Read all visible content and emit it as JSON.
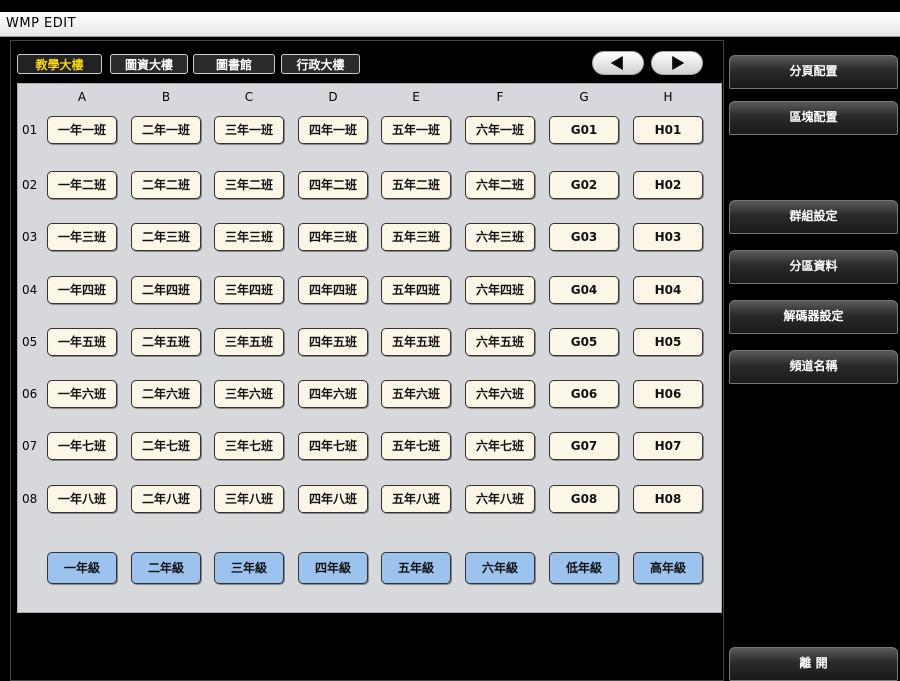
{
  "window": {
    "title": "WMP EDIT"
  },
  "buildings": [
    {
      "label": "教學大樓",
      "active": true
    },
    {
      "label": "圖資大樓",
      "active": false
    },
    {
      "label": "圖書館",
      "active": false
    },
    {
      "label": "行政大樓",
      "active": false
    }
  ],
  "columns": [
    "A",
    "B",
    "C",
    "D",
    "E",
    "F",
    "G",
    "H"
  ],
  "rows": [
    "01",
    "02",
    "03",
    "04",
    "05",
    "06",
    "07",
    "08"
  ],
  "cells": [
    [
      "一年一班",
      "二年一班",
      "三年一班",
      "四年一班",
      "五年一班",
      "六年一班",
      "G01",
      "H01"
    ],
    [
      "一年二班",
      "二年二班",
      "三年二班",
      "四年二班",
      "五年二班",
      "六年二班",
      "G02",
      "H02"
    ],
    [
      "一年三班",
      "二年三班",
      "三年三班",
      "四年三班",
      "五年三班",
      "六年三班",
      "G03",
      "H03"
    ],
    [
      "一年四班",
      "二年四班",
      "三年四班",
      "四年四班",
      "五年四班",
      "六年四班",
      "G04",
      "H04"
    ],
    [
      "一年五班",
      "二年五班",
      "三年五班",
      "四年五班",
      "五年五班",
      "六年五班",
      "G05",
      "H05"
    ],
    [
      "一年六班",
      "二年六班",
      "三年六班",
      "四年六班",
      "五年六班",
      "六年六班",
      "G06",
      "H06"
    ],
    [
      "一年七班",
      "二年七班",
      "三年七班",
      "四年七班",
      "五年七班",
      "六年七班",
      "G07",
      "H07"
    ],
    [
      "一年八班",
      "二年八班",
      "三年八班",
      "四年八班",
      "五年八班",
      "六年八班",
      "G08",
      "H08"
    ]
  ],
  "grades": [
    "一年級",
    "二年級",
    "三年級",
    "四年級",
    "五年級",
    "六年級",
    "低年級",
    "高年級"
  ],
  "sidebar": [
    {
      "name": "page-config-button",
      "label": "分頁配置"
    },
    {
      "name": "block-config-button",
      "label": "區塊配置"
    },
    {
      "name": "group-settings-button",
      "label": "群組設定"
    },
    {
      "name": "zone-data-button",
      "label": "分區資料"
    },
    {
      "name": "decoder-settings-button",
      "label": "解碼器設定"
    },
    {
      "name": "channel-name-button",
      "label": "頻道名稱"
    }
  ],
  "exit_label": "離 開",
  "colors": {
    "active_tab_text": "#f5d60a",
    "cell_bg": "#fbf6e6",
    "grade_bg": "#9cc3ee",
    "grid_bg": "#d6d8dc"
  },
  "icons": {
    "prev": "left-arrow-icon",
    "next": "right-arrow-icon"
  }
}
